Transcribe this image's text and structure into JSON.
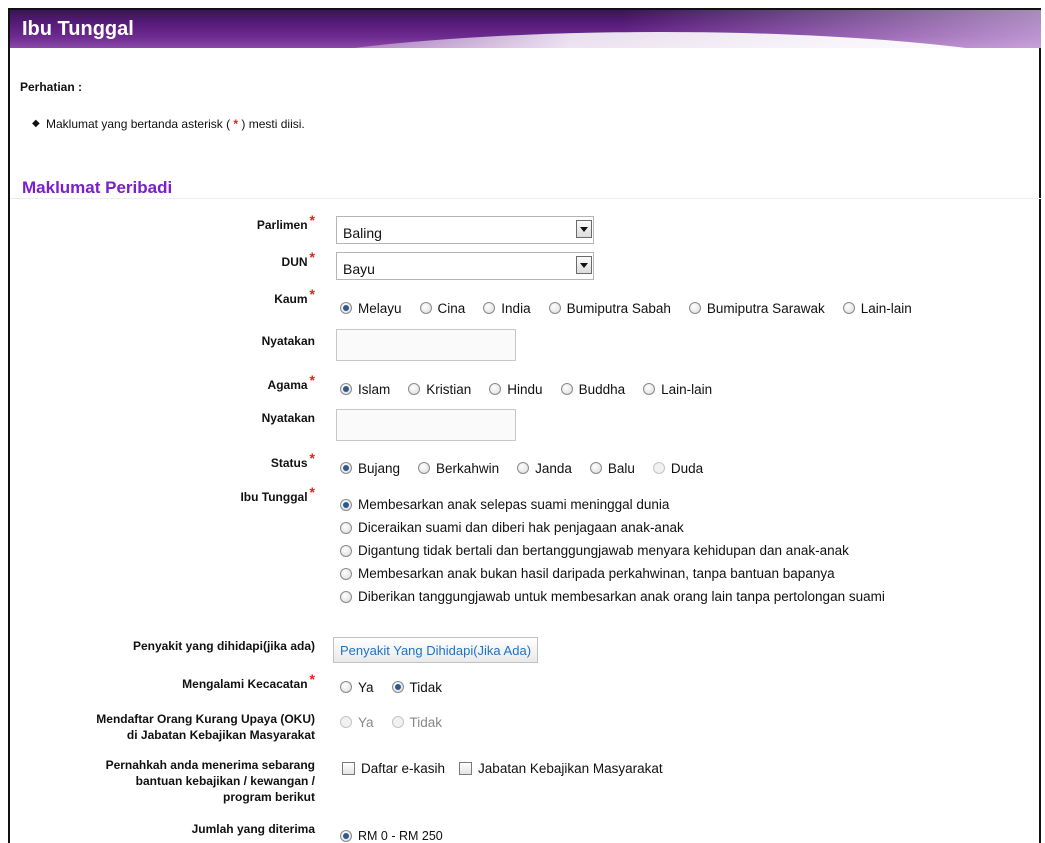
{
  "banner": {
    "title": "Ibu Tunggal"
  },
  "notice": {
    "heading": "Perhatian :",
    "item_before": "Maklumat yang bertanda asterisk ( ",
    "item_star": "*",
    "item_after": " ) mesti diisi."
  },
  "section": {
    "title": "Maklumat Peribadi"
  },
  "required_marker": "*",
  "form": {
    "parlimen": {
      "label": "Parlimen",
      "value": "Baling"
    },
    "dun": {
      "label": "DUN",
      "value": "Bayu"
    },
    "kaum": {
      "label": "Kaum",
      "options": [
        "Melayu",
        "Cina",
        "India",
        "Bumiputra Sabah",
        "Bumiputra Sarawak",
        "Lain-lain"
      ],
      "selected": "Melayu"
    },
    "kaum_nyatakan": {
      "label": "Nyatakan",
      "value": ""
    },
    "agama": {
      "label": "Agama",
      "options": [
        "Islam",
        "Kristian",
        "Hindu",
        "Buddha",
        "Lain-lain"
      ],
      "selected": "Islam"
    },
    "agama_nyatakan": {
      "label": "Nyatakan",
      "value": ""
    },
    "status": {
      "label": "Status",
      "options": [
        "Bujang",
        "Berkahwin",
        "Janda",
        "Balu",
        "Duda"
      ],
      "selected": "Bujang",
      "disabled": [
        "Duda"
      ]
    },
    "ibu_tunggal": {
      "label": "Ibu Tunggal",
      "options": [
        "Membesarkan anak selepas suami meninggal dunia",
        "Diceraikan suami dan diberi hak penjagaan anak-anak",
        "Digantung tidak bertali dan bertanggungjawab menyara kehidupan dan anak-anak",
        "Membesarkan anak bukan hasil daripada perkahwinan, tanpa bantuan bapanya",
        "Diberikan tanggungjawab untuk membesarkan anak orang lain tanpa pertolongan suami"
      ],
      "selected": "Membesarkan anak selepas suami meninggal dunia"
    },
    "penyakit": {
      "label": "Penyakit yang dihidapi(jika ada)",
      "button": "Penyakit Yang Dihidapi(Jika Ada)"
    },
    "kecacatan": {
      "label": "Mengalami Kecacatan",
      "options": [
        "Ya",
        "Tidak"
      ],
      "selected": "Tidak"
    },
    "oku": {
      "label_line1": "Mendaftar Orang Kurang Upaya (OKU)",
      "label_line2": "di Jabatan Kebajikan Masyarakat",
      "options": [
        "Ya",
        "Tidak"
      ],
      "disabled": true
    },
    "bantuan": {
      "label_line1": "Pernahkah anda menerima sebarang",
      "label_line2": "bantuan kebajikan / kewangan /",
      "label_line3": "program berikut",
      "options": [
        "Daftar e-kasih",
        "Jabatan Kebajikan Masyarakat"
      ]
    },
    "jumlah": {
      "label": "Jumlah yang diterima",
      "options": [
        "RM 0 - RM 250"
      ],
      "selected": "RM 0 - RM 250"
    }
  },
  "colors": {
    "banner_purple": "#5a1d7c",
    "section_title": "#7a1fcb",
    "required": "#e2231a",
    "link_button_text": "#1f73c4"
  }
}
